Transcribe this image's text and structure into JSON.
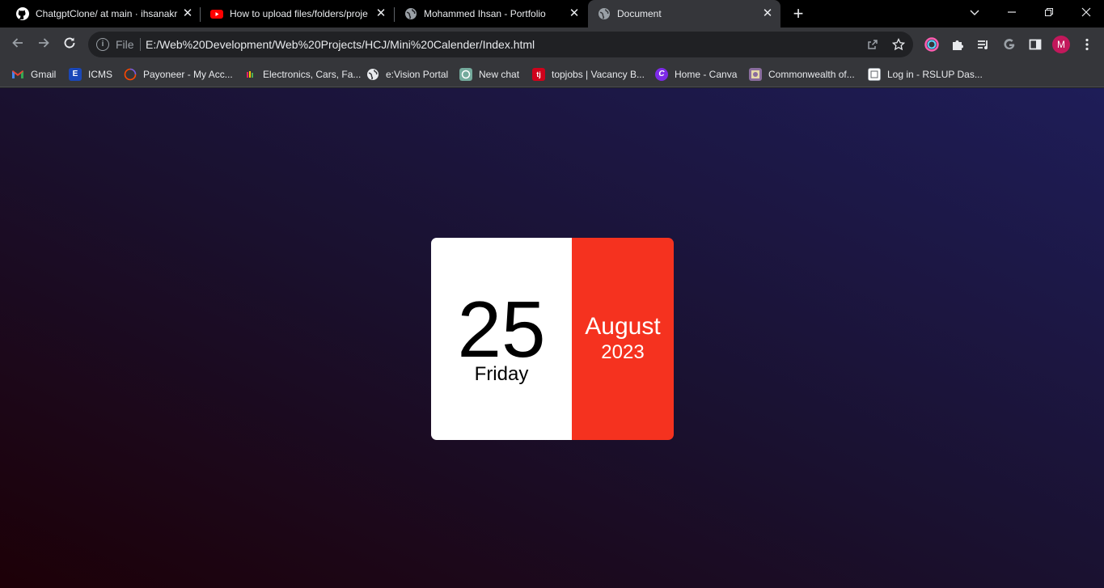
{
  "browser": {
    "tabs": [
      {
        "title": "ChatgptClone/ at main · ihsanakr",
        "icon": "github-icon",
        "active": false
      },
      {
        "title": "How to upload files/folders/proje",
        "icon": "youtube-icon",
        "active": false
      },
      {
        "title": "Mohammed Ihsan - Portfolio",
        "icon": "globe-icon",
        "active": false
      },
      {
        "title": "Document",
        "icon": "globe-icon",
        "active": true
      }
    ],
    "omnibox": {
      "scheme_label": "File",
      "url": "E:/Web%20Development/Web%20Projects/HCJ/Mini%20Calender/Index.html"
    },
    "profile_initial": "M",
    "bookmarks": [
      {
        "label": "Gmail",
        "icon": "gmail-icon",
        "color": "#ea4335"
      },
      {
        "label": "ICMS",
        "icon": "icms-icon",
        "color": "#1a47b8"
      },
      {
        "label": "Payoneer - My Acc...",
        "icon": "payoneer-icon",
        "color": "#ff4800"
      },
      {
        "label": "Electronics, Cars, Fa...",
        "icon": "ikman-icon",
        "color": "#ffc800"
      },
      {
        "label": "e:Vision Portal",
        "icon": "globe-icon",
        "color": "#e8eaed"
      },
      {
        "label": "New chat",
        "icon": "openai-icon",
        "color": "#74aa9c"
      },
      {
        "label": "topjobs | Vacancy B...",
        "icon": "topjobs-icon",
        "color": "#d0021b"
      },
      {
        "label": "Home - Canva",
        "icon": "canva-icon",
        "color": "#7d2ae8"
      },
      {
        "label": "Commonwealth of...",
        "icon": "col-icon",
        "color": "#8a6d9e"
      },
      {
        "label": "Log in - RSLUP Das...",
        "icon": "rslup-icon",
        "color": "#dadce0"
      }
    ]
  },
  "calendar": {
    "date": "25",
    "day": "Friday",
    "month": "August",
    "year": "2023",
    "accent_color": "#f5321f"
  }
}
